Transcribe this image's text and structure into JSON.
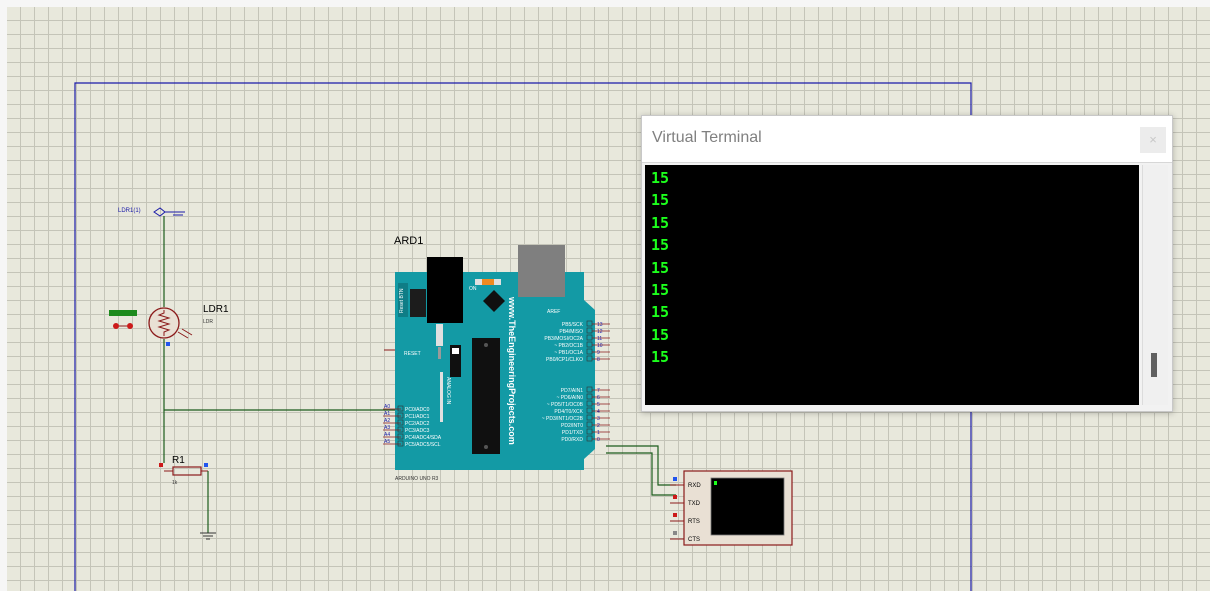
{
  "schematic": {
    "probe_label": "LDR1(1)",
    "ldr": {
      "ref": "LDR1",
      "value": "LDR"
    },
    "resistor": {
      "ref": "R1",
      "value": "1k"
    },
    "arduino": {
      "ref": "ARD1",
      "board_name": "ARDUINO UNO R3",
      "website": "www.TheEngineeringProjects.com",
      "reset_btn": "Reset BTN",
      "on_label": "ON",
      "reset_label": "RESET",
      "analog_label": "ANALOG IN",
      "aref": "AREF",
      "analog_pins": [
        "PC0/ADC0",
        "PC1/ADC1",
        "PC2/ADC2",
        "PC3/ADC3",
        "PC4/ADC4/SDA",
        "PC5/ADC5/SCL"
      ],
      "analog_pin_nums": [
        "A0",
        "A1",
        "A2",
        "A3",
        "A4",
        "A5"
      ],
      "digital_pins": [
        "PB5/SCK",
        "PB4/MISO",
        "PB3/MOSI/OC2A",
        "~ PB2/OC1B",
        "~ PB1/OC1A",
        "PB0/ICP1/CLKO",
        "PD7/AIN1",
        "~ PD6/AIN0",
        "~ PD5/T1/OC0B",
        "PD4/T0/XCK",
        "~ PD3/INT1/OC2B",
        "PD2/INT0",
        "PD1/TXD",
        "PD0/RXD"
      ],
      "digital_pin_nums": [
        "13",
        "12",
        "11",
        "10",
        "9",
        "8",
        "7",
        "6",
        "5",
        "4",
        "3",
        "2",
        "1",
        "0"
      ]
    },
    "terminal_symbol": {
      "pins": [
        "RXD",
        "TXD",
        "RTS",
        "CTS"
      ]
    }
  },
  "virtual_terminal": {
    "title": "Virtual Terminal",
    "close_label": "×",
    "lines": [
      "15",
      "15",
      "15",
      "15",
      "15",
      "15",
      "15",
      "15",
      "15"
    ]
  },
  "colors": {
    "wire": "#1c5c1c",
    "frame": "#1a1aa8",
    "component": "#8b1a1a",
    "board": "#139aa5",
    "terminal_text": "#1cff1c"
  }
}
